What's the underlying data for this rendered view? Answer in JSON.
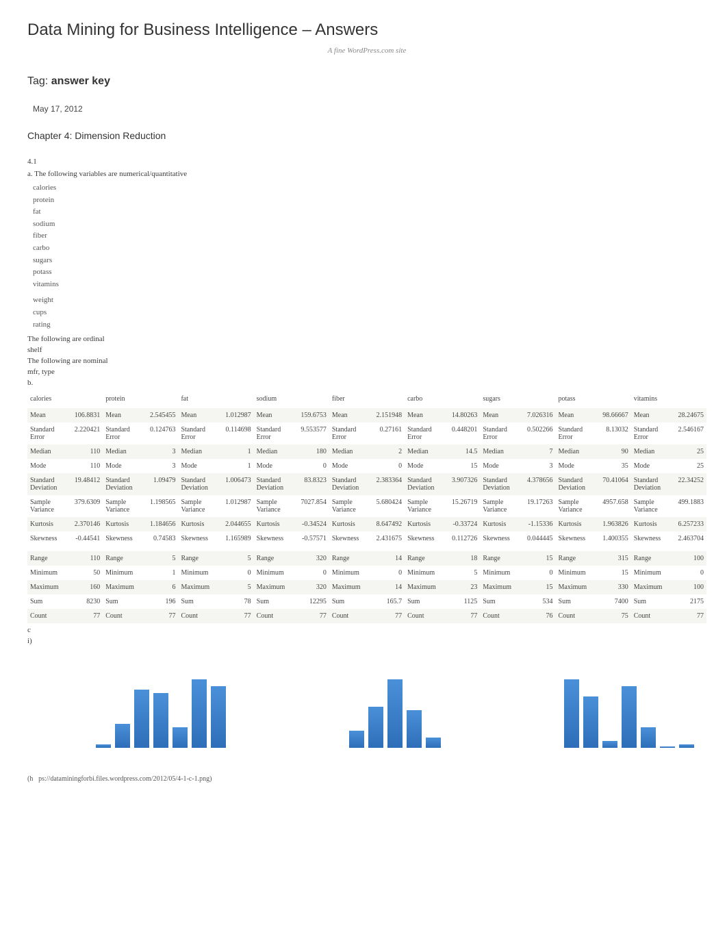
{
  "title": "Data Mining for Business Intelligence – Answers",
  "tagline": "A fine WordPress.com site",
  "tag_prefix": "Tag: ",
  "tag_name": "answer key",
  "date": "May 17, 2012",
  "chapter": "Chapter 4: Dimension Reduction",
  "sec41": "4.1",
  "q_a": "a. The following variables are numerical/quantitative",
  "vars1": [
    "calories",
    "protein",
    "fat",
    "sodium",
    "fiber",
    "carbo",
    "sugars",
    "potass",
    "vitamins"
  ],
  "vars2": [
    "weight",
    "cups",
    "rating"
  ],
  "ordinal_label": "The following are ordinal",
  "ordinal_val": "shelf",
  "nominal_label": "The following are nominal",
  "nominal_val": "mfr, type",
  "q_b": "b.",
  "cols": [
    "calories",
    "protein",
    "fat",
    "sodium",
    "fiber",
    "carbo",
    "sugars",
    "potass",
    "vitamins"
  ],
  "rows": [
    {
      "l": "Mean",
      "v": [
        "106.8831",
        "2.545455",
        "1.012987",
        "159.6753",
        "2.151948",
        "14.80263",
        "7.026316",
        "98.66667",
        "28.24675"
      ]
    },
    {
      "l": "Standard Error",
      "v": [
        "2.220421",
        "0.124763",
        "0.114698",
        "9.553577",
        "0.27161",
        "0.448201",
        "0.502266",
        "8.13032",
        "2.546167"
      ]
    },
    {
      "l": "Median",
      "v": [
        "110",
        "3",
        "1",
        "180",
        "2",
        "14.5",
        "7",
        "90",
        "25"
      ]
    },
    {
      "l": "Mode",
      "v": [
        "110",
        "3",
        "1",
        "0",
        "0",
        "15",
        "3",
        "35",
        "25"
      ]
    },
    {
      "l": "Standard Deviation",
      "v": [
        "19.48412",
        "1.09479",
        "1.006473",
        "83.8323",
        "2.383364",
        "3.907326",
        "4.378656",
        "70.41064",
        "22.34252"
      ]
    },
    {
      "l": "Sample Variance",
      "v": [
        "379.6309",
        "1.198565",
        "1.012987",
        "7027.854",
        "5.680424",
        "15.26719",
        "19.17263",
        "4957.658",
        "499.1883"
      ]
    },
    {
      "l": "Kurtosis",
      "v": [
        "2.370146",
        "1.184656",
        "2.044655",
        "-0.34524",
        "8.647492",
        "-0.33724",
        "-1.15336",
        "1.963826",
        "6.257233"
      ]
    },
    {
      "l": "Skewness",
      "v": [
        "-0.44541",
        "0.74583",
        "1.165989",
        "-0.57571",
        "2.431675",
        "0.112726",
        "0.044445",
        "1.400355",
        "2.463704"
      ]
    }
  ],
  "rows2": [
    {
      "l": "Range",
      "v": [
        "110",
        "5",
        "5",
        "320",
        "14",
        "18",
        "15",
        "315",
        "100"
      ]
    },
    {
      "l": "Minimum",
      "v": [
        "50",
        "1",
        "0",
        "0",
        "0",
        "5",
        "0",
        "15",
        "0"
      ]
    },
    {
      "l": "Maximum",
      "v": [
        "160",
        "6",
        "5",
        "320",
        "14",
        "23",
        "15",
        "330",
        "100"
      ]
    },
    {
      "l": "Sum",
      "v": [
        "8230",
        "196",
        "78",
        "12295",
        "165.7",
        "1125",
        "534",
        "7400",
        "2175"
      ]
    },
    {
      "l": "Count",
      "v": [
        "77",
        "77",
        "77",
        "77",
        "77",
        "77",
        "76",
        "75",
        "77"
      ]
    }
  ],
  "q_c": "c",
  "q_i": "i)",
  "caption": "(hps://dataminingforbi.files.wordpress.com/2012/05/4-1-c-1.png)",
  "chart_data": [
    {
      "type": "bar",
      "values": [
        5,
        35,
        85,
        80,
        30,
        100,
        90
      ]
    },
    {
      "type": "bar",
      "values": [
        25,
        60,
        100,
        55,
        15
      ]
    },
    {
      "type": "bar",
      "values": [
        100,
        75,
        10,
        90,
        30,
        2,
        5
      ]
    }
  ]
}
